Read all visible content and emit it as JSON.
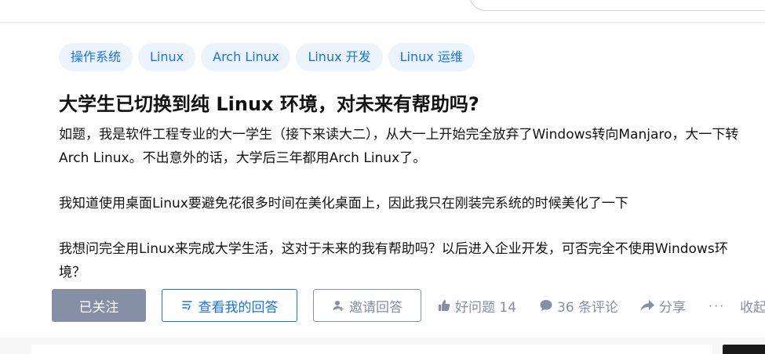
{
  "tags": [
    "操作系统",
    "Linux",
    "Arch Linux",
    "Linux 开发",
    "Linux 运维"
  ],
  "question": {
    "title": "大学生已切换到纯 Linux 环境，对未来有帮助吗?",
    "paragraphs": [
      "如题，我是软件工程专业的大一学生（接下来读大二），从大一上开始完全放弃了Windows转向Manjaro，大一下转Arch Linux。不出意外的话，大学后三年都用Arch Linux了。",
      "我知道使用桌面Linux要避免花很多时间在美化桌面上，因此我只在刚装完系统的时候美化了一下",
      "我想问完全用Linux来完成大学生活，这对于未来的我有帮助吗？以后进入企业开发，可否完全不使用Windows环境？"
    ]
  },
  "actions": {
    "follow_label": "已关注",
    "my_answer_label": "查看我的回答",
    "invite_label": "邀请回答",
    "good_question_label": "好问题 14",
    "comments_label": "36 条评论",
    "share_label": "分享",
    "more_label": "···",
    "collapse_label": "收起"
  },
  "colors": {
    "brand_blue": "#1772f6",
    "tag_bg": "#ebf3fd",
    "muted_gray": "#8590a6"
  },
  "icons": [
    "list-check-icon",
    "invite-user-icon",
    "thumbs-up-icon",
    "comment-bubble-icon",
    "share-arrow-icon",
    "more-dots-icon"
  ]
}
